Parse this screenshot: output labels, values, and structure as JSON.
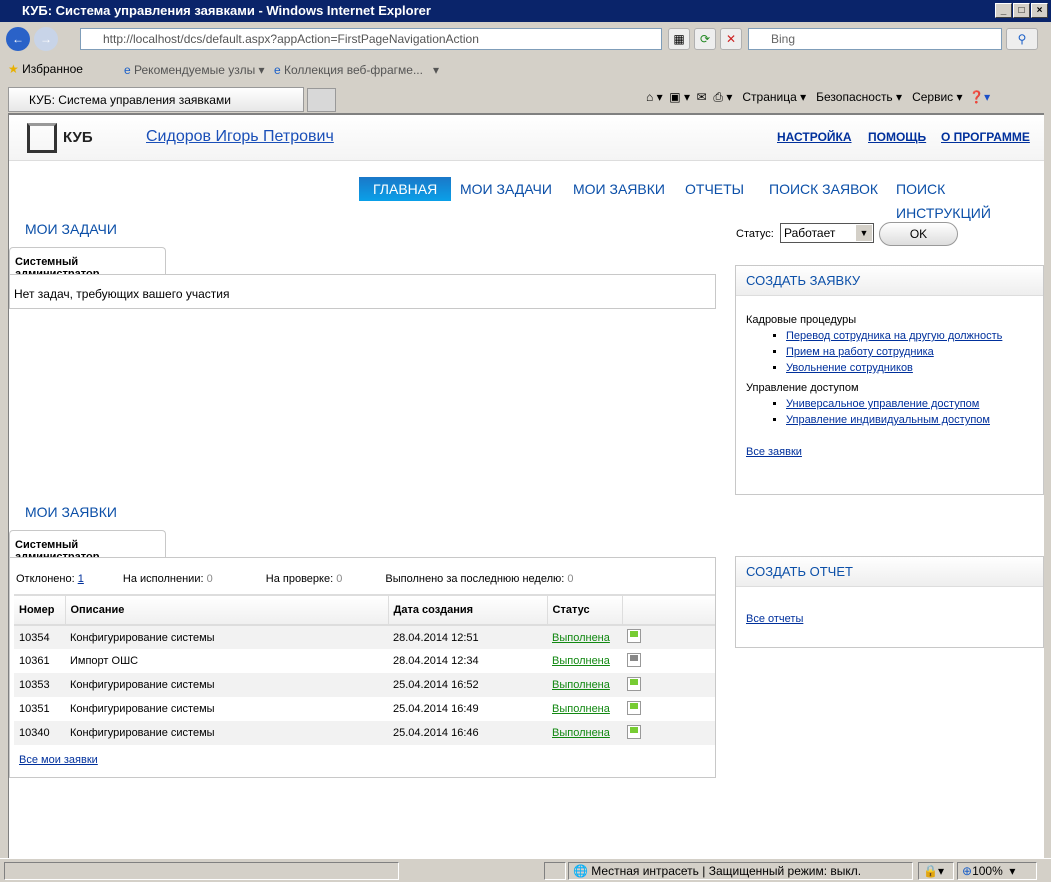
{
  "window": {
    "title": "КУБ: Система управления заявками - Windows Internet Explorer"
  },
  "browser": {
    "url": "http://localhost/dcs/default.aspx?appAction=FirstPageNavigationAction",
    "search_placeholder": "Bing",
    "favorites": "Избранное",
    "fav_links": [
      "Рекомендуемые узлы",
      "Коллекция веб-фрагме..."
    ],
    "tab_title": "КУБ: Система управления заявками",
    "commands": [
      "Страница",
      "Безопасность",
      "Сервис"
    ],
    "status_zone": "Местная интрасеть | Защищенный режим: выкл.",
    "zoom": "100%"
  },
  "header": {
    "logo": "КУБ",
    "user": "Сидоров Игорь Петрович",
    "links": [
      "НАСТРОЙКА",
      "ПОМОЩЬ",
      "О ПРОГРАММЕ"
    ]
  },
  "nav": [
    "ГЛАВНАЯ",
    "МОИ ЗАДАЧИ",
    "МОИ ЗАЯВКИ",
    "ОТЧЕТЫ",
    "ПОИСК ЗАЯВОК",
    "ПОИСК ИНСТРУКЦИЙ"
  ],
  "status": {
    "label": "Статус:",
    "value": "Работает",
    "ok": "OK"
  },
  "tasks": {
    "title": "МОИ ЗАДАЧИ",
    "tab": "Системный администратор",
    "empty": "Нет задач, требующих вашего участия"
  },
  "requests": {
    "title": "МОИ ЗАЯВКИ",
    "tab": "Системный администратор",
    "counters": [
      {
        "label": "Отклонено:",
        "value": "1"
      },
      {
        "label": "На исполнении:",
        "value": "0"
      },
      {
        "label": "На проверке:",
        "value": "0"
      },
      {
        "label": "Выполнено за последнюю неделю:",
        "value": "0"
      }
    ],
    "columns": [
      "Номер",
      "Описание",
      "Дата создания",
      "Статус"
    ],
    "rows": [
      {
        "id": "10354",
        "desc": "Конфигурирование системы",
        "date": "28.04.2014 12:51",
        "status": "Выполнена",
        "icon": "document-green-arrow-icon"
      },
      {
        "id": "10361",
        "desc": "Импорт ОШС",
        "date": "28.04.2014 12:34",
        "status": "Выполнена",
        "icon": "document-grey-arrow-icon"
      },
      {
        "id": "10353",
        "desc": "Конфигурирование системы",
        "date": "25.04.2014 16:52",
        "status": "Выполнена",
        "icon": "document-green-arrow-icon"
      },
      {
        "id": "10351",
        "desc": "Конфигурирование системы",
        "date": "25.04.2014 16:49",
        "status": "Выполнена",
        "icon": "document-green-arrow-icon"
      },
      {
        "id": "10340",
        "desc": "Конфигурирование системы",
        "date": "25.04.2014 16:46",
        "status": "Выполнена",
        "icon": "document-green-arrow-icon"
      }
    ],
    "all": "Все мои заявки"
  },
  "create_request": {
    "title": "СОЗДАТЬ ЗАЯВКУ",
    "groups": [
      {
        "name": "Кадровые процедуры",
        "items": [
          "Перевод сотрудника на другую должность",
          "Прием на работу сотрудника",
          "Увольнение сотрудников"
        ]
      },
      {
        "name": "Управление доступом",
        "items": [
          "Универсальное управление доступом",
          "Управление индивидуальным доступом"
        ]
      }
    ],
    "all": "Все заявки"
  },
  "create_report": {
    "title": "СОЗДАТЬ ОТЧЕТ",
    "all": "Все отчеты"
  },
  "colors": {
    "titlebar": "#0a246a",
    "nav_active": "#1a78c8",
    "link": "#00309c",
    "status_done": "#118811"
  }
}
